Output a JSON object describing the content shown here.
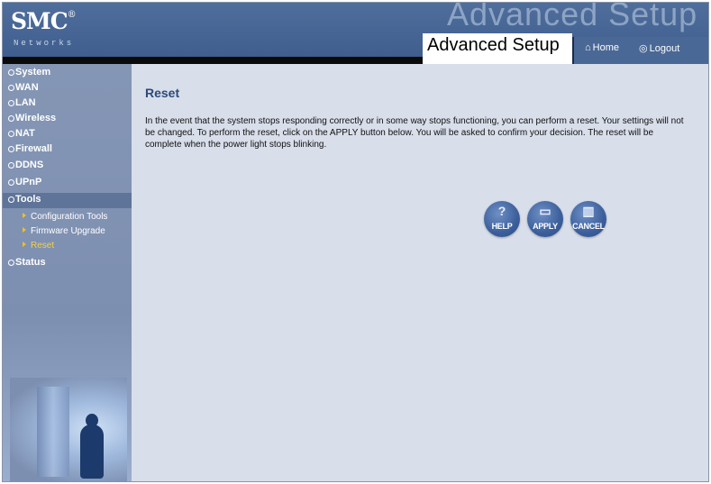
{
  "brand": {
    "name": "SMC",
    "registered": "®",
    "tagline": "Networks"
  },
  "header": {
    "ghost_title": "Advanced Setup",
    "title": "Advanced Setup",
    "home_label": "Home",
    "logout_label": "Logout"
  },
  "sidebar": {
    "items": [
      {
        "label": "System"
      },
      {
        "label": "WAN"
      },
      {
        "label": "LAN"
      },
      {
        "label": "Wireless"
      },
      {
        "label": "NAT"
      },
      {
        "label": "Firewall"
      },
      {
        "label": "DDNS"
      },
      {
        "label": "UPnP"
      },
      {
        "label": "Tools"
      },
      {
        "label": "Status"
      }
    ],
    "sub_items": [
      {
        "label": "Configuration Tools"
      },
      {
        "label": "Firmware Upgrade"
      },
      {
        "label": "Reset"
      }
    ]
  },
  "main": {
    "title": "Reset",
    "description": "In the event that the system stops responding correctly or in some way stops functioning, you can perform a reset. Your settings will not be changed. To perform the reset, click on the APPLY button below. You will be asked to confirm your decision. The reset will be complete when the power light stops blinking.",
    "buttons": {
      "help": "HELP",
      "apply": "APPLY",
      "cancel": "CANCEL"
    }
  },
  "colors": {
    "header": "#3d5c8c",
    "sidebar": "#8596b5",
    "content": "#d8deea",
    "title": "#2b4a7a",
    "active_sub": "#f2d04a"
  }
}
